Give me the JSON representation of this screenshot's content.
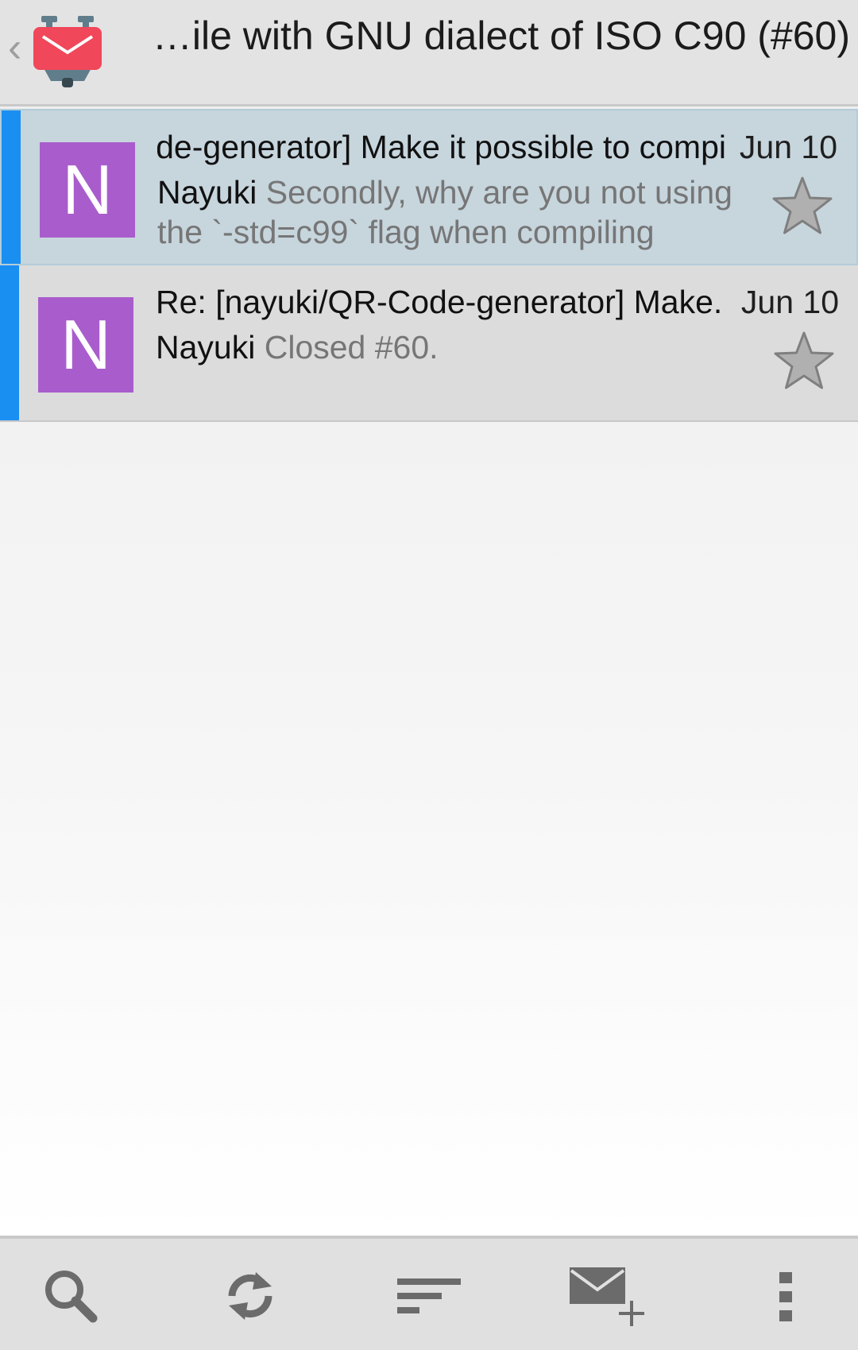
{
  "header": {
    "back_icon": "chevron-left-icon",
    "logo_icon": "k9-mail-logo-icon",
    "title": "…ile with GNU dialect of ISO C90 (#60)"
  },
  "messages": [
    {
      "subject": "Re: [nayuki/QR-Code-generator] Make it possible to compi",
      "date": "Jun 10",
      "sender": "Nayuki",
      "preview": "Secondly, why are you not using the `-std=c99` flag when compiling",
      "avatar_letter": "N",
      "unread": true,
      "selected": true,
      "starred": false
    },
    {
      "subject": "Re: [nayuki/QR-Code-generator] Make..",
      "date": "Jun 10",
      "sender": "Nayuki",
      "preview": "Closed #60.",
      "avatar_letter": "N",
      "unread": true,
      "selected": false,
      "starred": false
    }
  ],
  "bottombar": {
    "icons": [
      "search-icon",
      "refresh-icon",
      "sort-icon",
      "compose-icon",
      "overflow-menu-icon"
    ]
  },
  "colors": {
    "unread_indicator": "#1a8ff2",
    "avatar": "#a95dcc",
    "selected_row": "#c7d5dd",
    "logo_red": "#f0475a"
  }
}
